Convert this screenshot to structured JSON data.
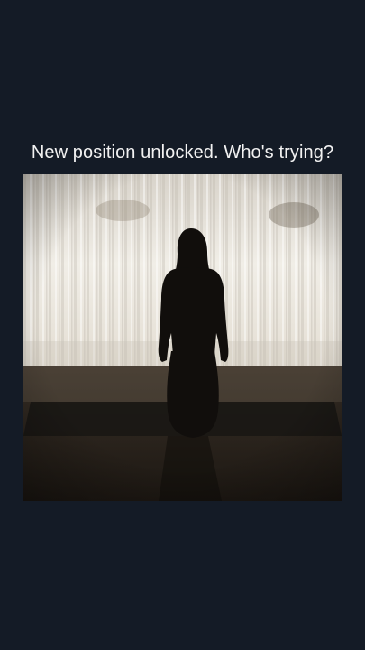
{
  "post": {
    "caption": "New position unlocked. Who's trying?"
  },
  "media": {
    "kind": "video-frame",
    "colors": {
      "background": "#141b26",
      "curtain_light": "#ede9e1",
      "curtain_shadow": "#b9b3a8",
      "floor": "#2a231d",
      "silhouette": "#120f0d"
    }
  }
}
